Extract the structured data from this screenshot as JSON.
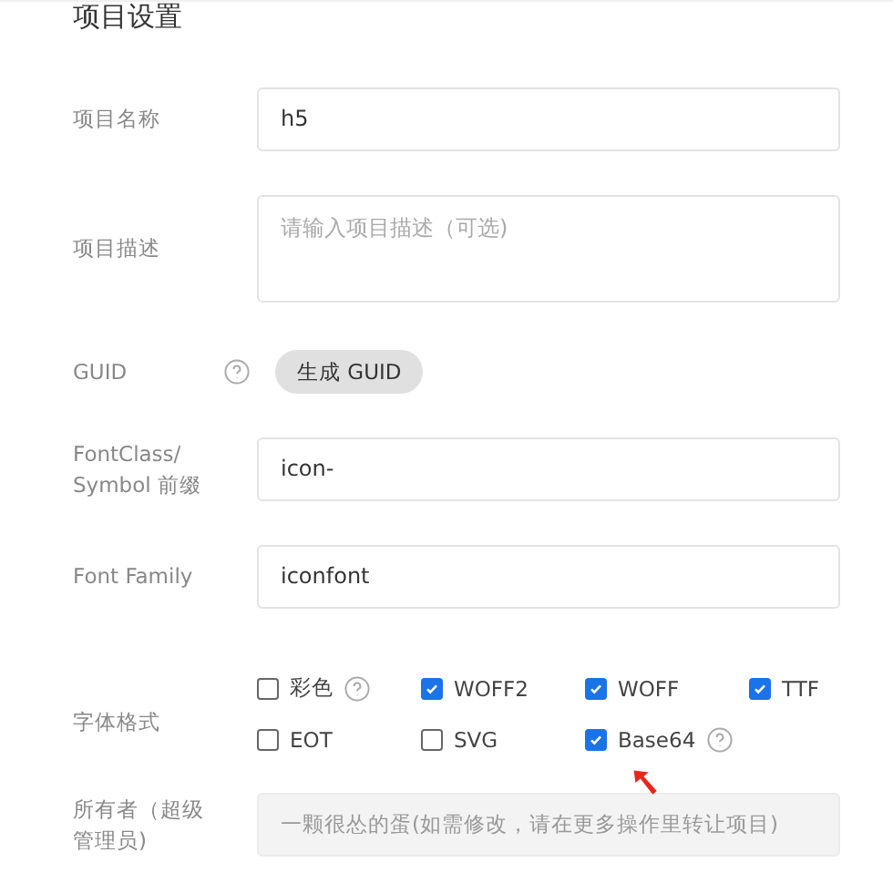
{
  "title": "项目设置",
  "rows": [
    {
      "kind": "text",
      "label": "项目名称",
      "help": false,
      "value": "h5",
      "disabled": false
    },
    {
      "kind": "textarea",
      "label": "项目描述",
      "help": false,
      "placeholder": "请输入项目描述（可选)"
    },
    {
      "kind": "button",
      "label": "GUID",
      "help": true,
      "button": "生成 GUID"
    },
    {
      "kind": "text",
      "label": "FontClass/ Symbol 前缀",
      "help": false,
      "value": "icon-",
      "disabled": false
    },
    {
      "kind": "text",
      "label": "Font Family",
      "help": false,
      "value": "iconfont",
      "disabled": false
    },
    {
      "kind": "checkboxes",
      "label": "字体格式",
      "help": false,
      "options": [
        {
          "label": "彩色",
          "checked": false,
          "help": true
        },
        {
          "label": "WOFF2",
          "checked": true,
          "help": false
        },
        {
          "label": "WOFF",
          "checked": true,
          "help": false
        },
        {
          "label": "TTF",
          "checked": true,
          "help": false
        },
        {
          "label": "EOT",
          "checked": false,
          "help": false
        },
        {
          "label": "SVG",
          "checked": false,
          "help": false
        },
        {
          "label": "Base64",
          "checked": true,
          "help": true
        }
      ]
    },
    {
      "kind": "text",
      "label": "所有者（超级管理员)",
      "help": false,
      "placeholder": "一颗很怂的蛋(如需修改，请在更多操作里转让项目)",
      "disabled": true
    }
  ]
}
